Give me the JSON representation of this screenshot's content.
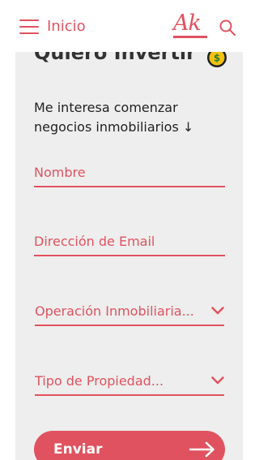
{
  "header": {
    "menu_icon": "hamburger-menu-icon",
    "nav_label": "Inicio",
    "logo_text": "Ak",
    "search_icon": "search-icon"
  },
  "card": {
    "title": "Quiero Invertir",
    "coin_icon": "dollar-coin-icon",
    "description": "Me interesa comenzar negocios inmobiliarios ↓"
  },
  "form": {
    "name_placeholder": "Nombre",
    "email_placeholder": "Dirección de Email",
    "operation_select": "Operación Inmobiliaria...",
    "property_select": "Tipo de Propiedad...",
    "submit_label": "Enviar",
    "submit_icon": "arrow-right-icon"
  },
  "colors": {
    "accent": "#e0525f",
    "card_background": "#eeeeee",
    "text_dark": "#333333"
  }
}
